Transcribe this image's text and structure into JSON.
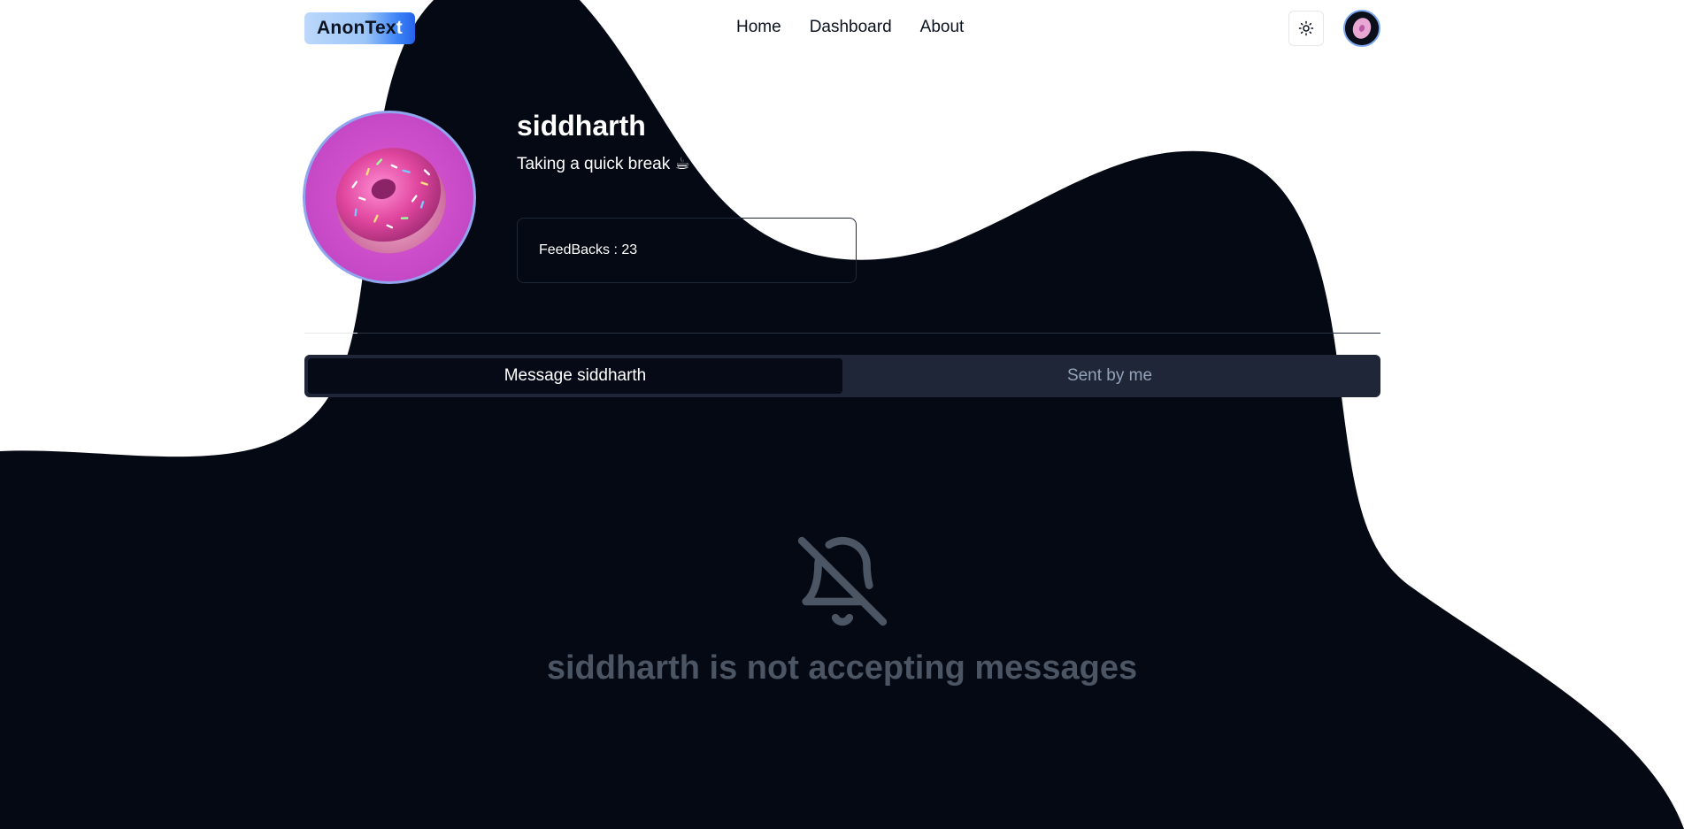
{
  "app": {
    "logo_text": "AnonTex",
    "logo_text_last": "t"
  },
  "nav": {
    "items": [
      {
        "label": "Home"
      },
      {
        "label": "Dashboard"
      },
      {
        "label": "About"
      }
    ]
  },
  "profile": {
    "username": "siddharth",
    "status": "Taking a quick break ☕",
    "feedbacks_label": "FeedBacks : 23"
  },
  "tabs": [
    {
      "label": "Message siddharth",
      "active": true
    },
    {
      "label": "Sent by me",
      "active": false
    }
  ],
  "empty_state": {
    "icon": "bell-off-icon",
    "message": "siddharth is not accepting messages"
  },
  "colors": {
    "dark_background": "#050913",
    "accent_blue": "#3b82f6",
    "muted_text": "#4b5563"
  }
}
